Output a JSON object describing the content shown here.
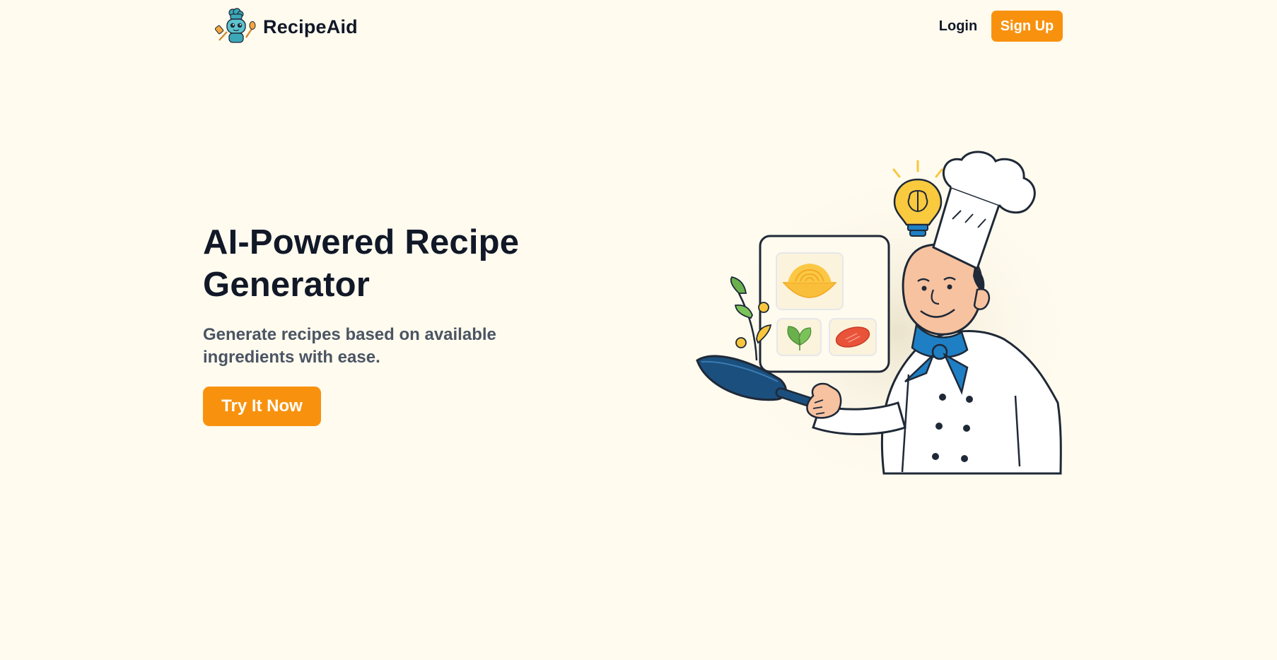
{
  "brand": {
    "name": "RecipeAid",
    "logo_icon": "chef-robot-icon"
  },
  "nav": {
    "login_label": "Login",
    "signup_label": "Sign Up"
  },
  "hero": {
    "title": "AI-Powered Recipe Generator",
    "subtitle": "Generate recipes based on available ingredients with ease.",
    "cta_label": "Try It Now",
    "illustration_icon": "chef-illustration"
  },
  "colors": {
    "background": "#fffbef",
    "accent": "#f8920e",
    "heading": "#111827",
    "body_text": "#4b5563",
    "scarf_blue": "#1f7fc4",
    "bulb_yellow": "#f7c63c"
  }
}
